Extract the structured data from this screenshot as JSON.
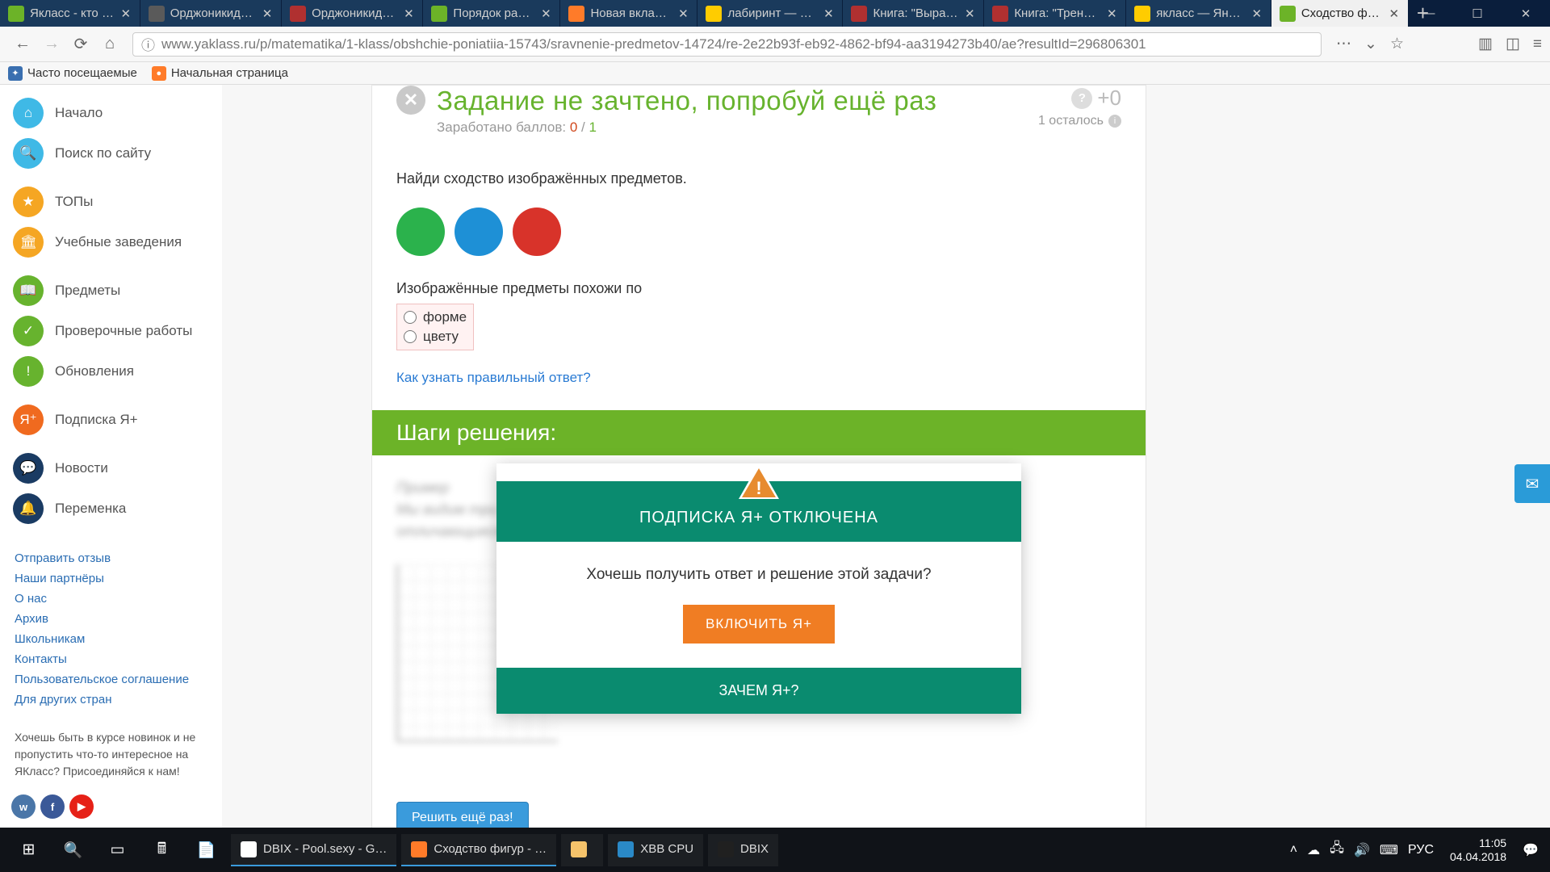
{
  "browser": {
    "tabs": [
      {
        "title": "Якласс - кто попал",
        "favbg": "#6cb328"
      },
      {
        "title": "Орджоникидзевски",
        "favbg": "#5a5a5a"
      },
      {
        "title": "Орджоникидзевски",
        "favbg": "#b03030"
      },
      {
        "title": "Порядок работы в",
        "favbg": "#6cb328"
      },
      {
        "title": "Новая вкладка",
        "favbg": "#ff7b29"
      },
      {
        "title": "лабиринт — Яндекс",
        "favbg": "#ffcc00"
      },
      {
        "title": "Книга: \"Вырабатыв",
        "favbg": "#b03030"
      },
      {
        "title": "Книга: \"Тренажер п",
        "favbg": "#b03030"
      },
      {
        "title": "якласс — Яндекс: н",
        "favbg": "#ffcc00"
      },
      {
        "title": "Сходство фигур",
        "favbg": "#6cb328",
        "active": true
      }
    ],
    "url": "www.yaklass.ru/p/matematika/1-klass/obshchie-poniatiia-15743/sravnenie-predmetov-14724/re-2e22b93f-eb92-4862-bf94-aa3194273b40/ae?resultId=296806301",
    "bookmarks": {
      "frequent": "Часто посещаемые",
      "startpage": "Начальная страница"
    }
  },
  "sidebar": {
    "items": [
      {
        "label": "Начало",
        "color": "#3fb9e6",
        "glyph": "⌂"
      },
      {
        "label": "Поиск по сайту",
        "color": "#3fb9e6",
        "glyph": "🔍"
      },
      {
        "label": "ТОПы",
        "color": "#f5a623",
        "glyph": "★"
      },
      {
        "label": "Учебные заведения",
        "color": "#f5a623",
        "glyph": "🏛"
      },
      {
        "label": "Предметы",
        "color": "#67b32e",
        "glyph": "📖"
      },
      {
        "label": "Проверочные работы",
        "color": "#67b32e",
        "glyph": "✓"
      },
      {
        "label": "Обновления",
        "color": "#67b32e",
        "glyph": "!"
      },
      {
        "label": "Подписка Я+",
        "color": "#f06a1f",
        "glyph": "Я⁺"
      },
      {
        "label": "Новости",
        "color": "#1a3b63",
        "glyph": "💬"
      },
      {
        "label": "Переменка",
        "color": "#1a3b63",
        "glyph": "🔔"
      }
    ],
    "links": [
      "Отправить отзыв",
      "Наши партнёры",
      "О нас",
      "Архив",
      "Школьникам",
      "Контакты",
      "Пользовательское соглашение",
      "Для других стран"
    ],
    "newsblock": "Хочешь быть в курсе новинок и не пропустить что-то интересное на ЯКласс? Присоединяйся к нам!"
  },
  "header": {
    "title": "Задание не зачтено, попробуй ещё раз",
    "earned_label": "Заработано баллов:",
    "score": "0",
    "score_sep": "/",
    "score_max": "1",
    "plus": "+0",
    "remaining": "1 осталось"
  },
  "task": {
    "prompt": "Найди сходство изображённых предметов.",
    "circles": [
      "#2bb24c",
      "#1e90d6",
      "#d8332a"
    ],
    "answer_label": "Изображённые предметы  похожи по",
    "opt1": "форме",
    "opt2": "цвету",
    "hint": "Как узнать правильный ответ?"
  },
  "steps": {
    "header": "Шаги решения:",
    "blurred_title": "Пример",
    "overlay": {
      "head": "ПОДПИСКА Я+ ОТКЛЮЧЕНА",
      "msg": "Хочешь получить ответ и решение этой задачи?",
      "btn": "ВКЛЮЧИТЬ Я+",
      "foot": "ЗАЧЕМ Я+?"
    }
  },
  "retry_label": "Решить ещё раз!",
  "taskbar": {
    "items": [
      {
        "label": "DBIX - Pool.sexy - G…",
        "iconbg": "#ffffff"
      },
      {
        "label": "Сходство фигур - …",
        "iconbg": "#ff7b29"
      },
      {
        "label": "",
        "iconbg": "#f5c36b"
      },
      {
        "label": "XBB CPU",
        "iconbg": "#2a89c7"
      },
      {
        "label": "DBIX",
        "iconbg": "#202020"
      }
    ],
    "lang": "РУС",
    "time": "11:05",
    "date": "04.04.2018"
  }
}
